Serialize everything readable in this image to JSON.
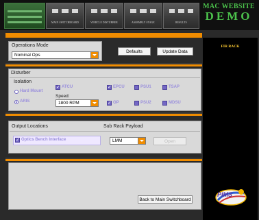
{
  "nav": {
    "tabs": [
      {
        "label": "MAIN SWITCHBOARD"
      },
      {
        "label": "VEHICLE DISTURBER"
      },
      {
        "label": "ASSEMBLY STAGE"
      },
      {
        "label": "RESULTS"
      }
    ],
    "brand": {
      "line1": "MAC WEBSITE",
      "line2": "DEMO"
    }
  },
  "operations": {
    "title": "Operations Mode",
    "selected": "Nominal Ops",
    "defaults_label": "Defaults",
    "update_label": "Update Data"
  },
  "disturber": {
    "title": "Disturber",
    "isolation_label": "Isolation",
    "radios": [
      {
        "label": "Hard Mount",
        "checked": false
      },
      {
        "label": "ARIS",
        "checked": true
      }
    ],
    "speed_label": "Speed:",
    "speed_value": "1800 RPM",
    "checkboxes": [
      {
        "label": "ATCU",
        "checked": true
      },
      {
        "label": "EPCU",
        "checked": true
      },
      {
        "label": "PSU1",
        "checked": false
      },
      {
        "label": "TSAP",
        "checked": false
      },
      {
        "label": "OP",
        "checked": true
      },
      {
        "label": "PSU2",
        "checked": false
      },
      {
        "label": "MDSU",
        "checked": false
      }
    ]
  },
  "output": {
    "title": "Output Locations",
    "payload_title": "Sub Rack Payload",
    "optics_label": "Optics Bench Interface",
    "payload_value": "LMM",
    "open_label": "Open"
  },
  "footer": {
    "back_label": "Back to Main Switchboard"
  },
  "rack": {
    "title": "FIR RACK",
    "logo_text": "PIMS"
  }
}
